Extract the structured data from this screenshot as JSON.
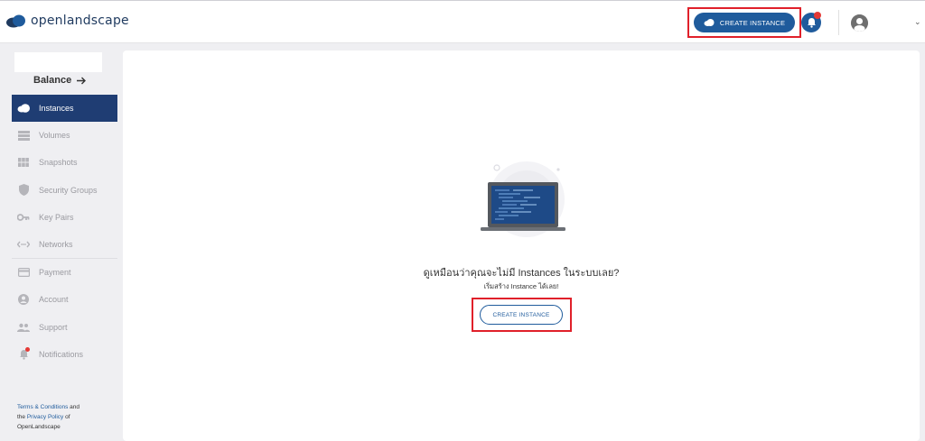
{
  "header": {
    "logo_prefix": "open",
    "logo_suffix": "landscape",
    "create_button": "CREATE INSTANCE"
  },
  "sidebar": {
    "balance_label": "Balance",
    "items": [
      {
        "label": "Instances",
        "icon": "cloud-icon",
        "active": true
      },
      {
        "label": "Volumes",
        "icon": "volumes-icon"
      },
      {
        "label": "Snapshots",
        "icon": "snapshots-icon"
      },
      {
        "label": "Security Groups",
        "icon": "shield-icon"
      },
      {
        "label": "Key Pairs",
        "icon": "key-icon"
      },
      {
        "label": "Networks",
        "icon": "network-icon"
      },
      {
        "label": "Payment",
        "icon": "card-icon"
      },
      {
        "label": "Account",
        "icon": "account-icon"
      },
      {
        "label": "Support",
        "icon": "support-icon"
      },
      {
        "label": "Notifications",
        "icon": "bell-icon"
      }
    ],
    "footer": {
      "terms": "Terms & Conditions",
      "and": " and",
      "the": "the ",
      "privacy": "Privacy Policy",
      "of": " of",
      "company": "OpenLandscape"
    }
  },
  "main": {
    "empty_title": "ดูเหมือนว่าคุณจะไม่มี Instances ในระบบเลย?",
    "empty_subtitle": "เริ่มสร้าง Instance ได้เลย!",
    "create_button": "CREATE INSTANCE"
  },
  "colors": {
    "primary": "#1f5b9c",
    "nav_active": "#1f3d73",
    "highlight": "#e0202a",
    "notification": "#e53935"
  }
}
